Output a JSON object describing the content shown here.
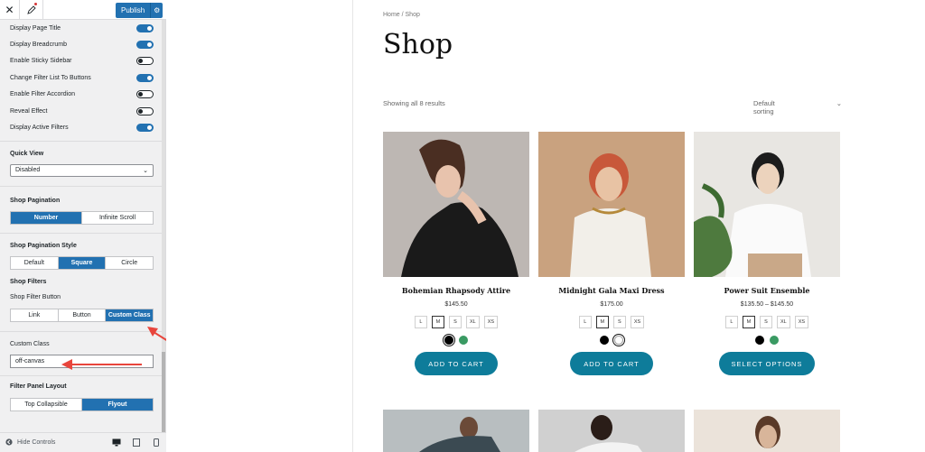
{
  "topbar": {
    "close_icon": "close-icon",
    "customize_icon": "pen-icon",
    "publish_label": "Publish",
    "settings_icon": "gear-icon"
  },
  "toggles": [
    {
      "label": "Display Page Title",
      "on": true
    },
    {
      "label": "Display Breadcrumb",
      "on": true
    },
    {
      "label": "Enable Sticky Sidebar",
      "on": false
    },
    {
      "label": "Change Filter List To Buttons",
      "on": true
    },
    {
      "label": "Enable Filter Accordion",
      "on": false
    },
    {
      "label": "Reveal Effect",
      "on": false
    },
    {
      "label": "Display Active Filters",
      "on": true
    }
  ],
  "quick_view": {
    "title": "Quick View",
    "value": "Disabled"
  },
  "pagination": {
    "title": "Shop Pagination",
    "options": [
      "Number",
      "Infinite Scroll"
    ],
    "active": 0
  },
  "pagination_style": {
    "title": "Shop Pagination Style",
    "options": [
      "Default",
      "Square",
      "Circle"
    ],
    "active": 1
  },
  "filters": {
    "title": "Shop Filters",
    "button_title": "Shop Filter Button",
    "options": [
      "Link",
      "Button",
      "Custom Class"
    ],
    "active": 2
  },
  "custom_class": {
    "label": "Custom Class",
    "value": "off-canvas"
  },
  "panel_layout": {
    "title": "Filter Panel Layout",
    "options": [
      "Top Collapsible",
      "Flyout"
    ],
    "active": 1
  },
  "bottombar": {
    "hide_label": "Hide Controls"
  },
  "preview": {
    "breadcrumb": "Home / Shop",
    "title": "Shop",
    "results": "Showing all 8 results",
    "sorting": "Default sorting",
    "products": [
      {
        "name": "Bohemian Rhapsody Attire",
        "price": "$145.50",
        "sizes": [
          "L",
          "M",
          "S",
          "XL",
          "XS"
        ],
        "selected_size": "M",
        "button": "ADD TO CART"
      },
      {
        "name": "Midnight Gala Maxi Dress",
        "price": "$175.00",
        "sizes": [
          "L",
          "M",
          "S",
          "XS"
        ],
        "selected_size": "M",
        "button": "ADD TO CART"
      },
      {
        "name": "Power Suit Ensemble",
        "price": "$135.50 – $145.50",
        "sizes": [
          "L",
          "M",
          "S",
          "XL",
          "XS"
        ],
        "selected_size": "M",
        "button": "SELECT OPTIONS"
      }
    ]
  },
  "colors": {
    "accent": "#2271b1",
    "button": "#0e7c9a",
    "annotation": "#e8453c"
  }
}
